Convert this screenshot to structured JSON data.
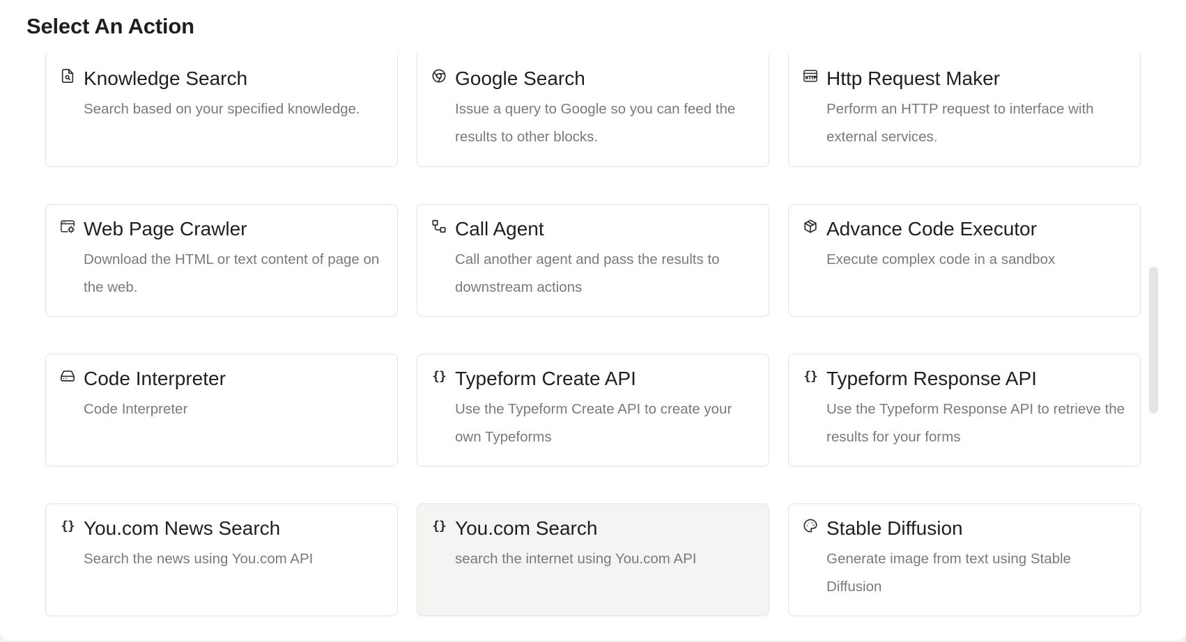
{
  "dialog": {
    "title": "Select An Action"
  },
  "cards": [
    {
      "icon": "document-search-icon",
      "title": "Knowledge Search",
      "description": "Search based on your specified knowledge."
    },
    {
      "icon": "google-chrome-icon",
      "title": "Google Search",
      "description": "Issue a query to Google so you can feed the results to other blocks."
    },
    {
      "icon": "http-icon",
      "title": "Http Request Maker",
      "description": "Perform an HTTP request to interface with external services."
    },
    {
      "icon": "web-crawler-icon",
      "title": "Web Page Crawler",
      "description": "Download the HTML or text content of page on the web."
    },
    {
      "icon": "flow-icon",
      "title": "Call Agent",
      "description": "Call another agent and pass the results to downstream actions"
    },
    {
      "icon": "cube-icon",
      "title": "Advance Code Executor",
      "description": "Execute complex code in a sandbox"
    },
    {
      "icon": "hard-drive-icon",
      "title": "Code Interpreter",
      "description": "Code Interpreter"
    },
    {
      "icon": "braces-icon",
      "title": "Typeform Create API",
      "description": "Use the Typeform Create API to create your own Typeforms"
    },
    {
      "icon": "braces-icon",
      "title": "Typeform Response API",
      "description": "Use the Typeform Response API to retrieve the results for your forms"
    },
    {
      "icon": "braces-icon",
      "title": "You.com News Search",
      "description": "Search the news using You.com API"
    },
    {
      "icon": "braces-icon",
      "title": "You.com Search",
      "description": "search the internet using You.com API"
    },
    {
      "icon": "palette-icon",
      "title": "Stable Diffusion",
      "description": "Generate image from text using Stable Diffusion"
    }
  ],
  "selected_card": "You.com Search"
}
